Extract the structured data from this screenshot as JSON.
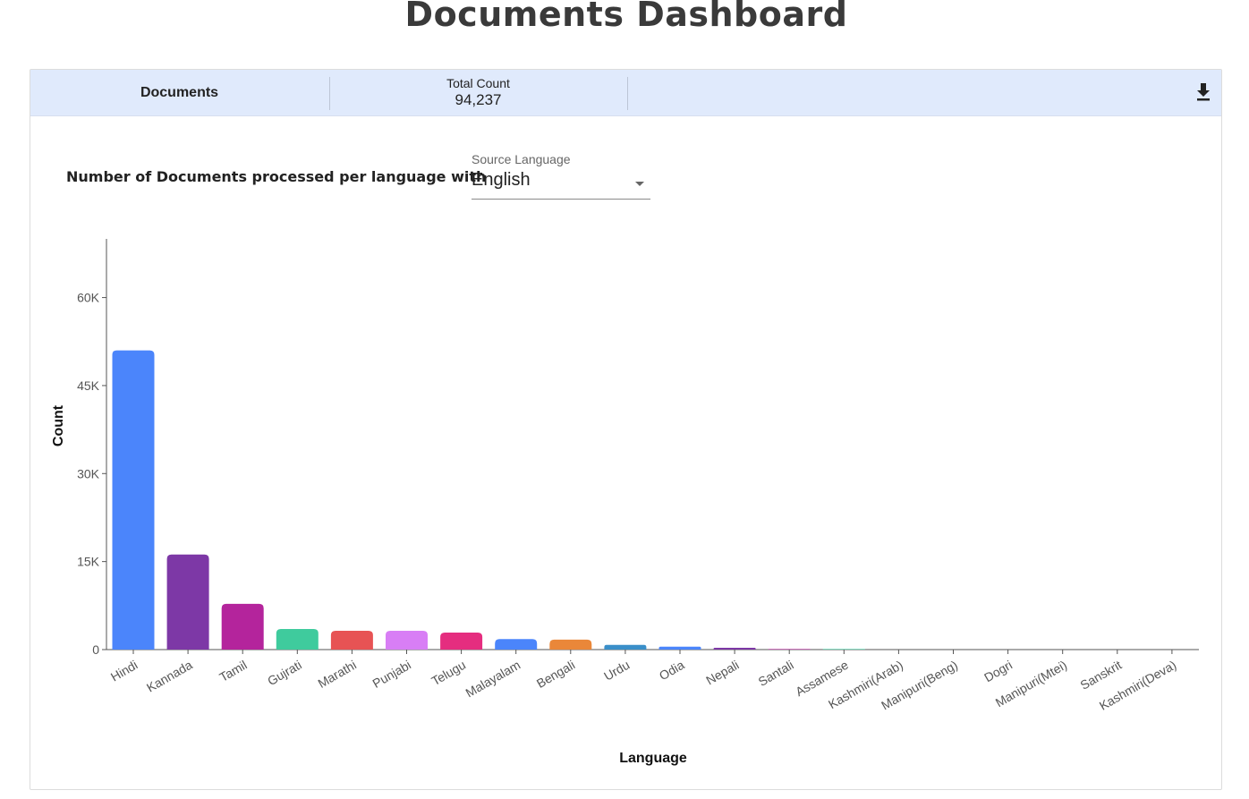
{
  "page": {
    "title": "Documents Dashboard"
  },
  "header": {
    "documents_label": "Documents",
    "total_label": "Total Count",
    "total_value": "94,237",
    "download_icon": "download-icon"
  },
  "filter": {
    "heading": "Number of Documents processed per language with",
    "source_label": "Source Language",
    "source_value": "English"
  },
  "chart_data": {
    "type": "bar",
    "xlabel": "Language",
    "ylabel": "Count",
    "ylim": [
      0,
      70000
    ],
    "yticks": [
      0,
      15000,
      30000,
      45000,
      60000
    ],
    "ytick_labels": [
      "0",
      "15K",
      "30K",
      "45K",
      "60K"
    ],
    "grid": false,
    "categories": [
      "Hindi",
      "Kannada",
      "Tamil",
      "Gujrati",
      "Marathi",
      "Punjabi",
      "Telugu",
      "Malayalam",
      "Bengali",
      "Urdu",
      "Odia",
      "Nepali",
      "Santali",
      "Assamese",
      "Kashmiri(Arab)",
      "Manipuri(Beng)",
      "Dogri",
      "Manipuri(Mtei)",
      "Sanskrit",
      "Kashmiri(Deva)"
    ],
    "values": [
      51000,
      16200,
      7800,
      3500,
      3200,
      3200,
      2900,
      1800,
      1700,
      800,
      500,
      300,
      100,
      100,
      0,
      0,
      0,
      0,
      0,
      0
    ],
    "colors": [
      "#4b85fb",
      "#7d38a6",
      "#b4249c",
      "#3fcb9d",
      "#e75354",
      "#d87ef5",
      "#e52d7f",
      "#4b85fb",
      "#ea8739",
      "#3a8fc9",
      "#4b85fb",
      "#7d38a6",
      "#b4249c",
      "#3fcb9d",
      "#e75354",
      "#d87ef5",
      "#e52d7f",
      "#4b85fb",
      "#ea8739",
      "#3a8fc9"
    ]
  }
}
